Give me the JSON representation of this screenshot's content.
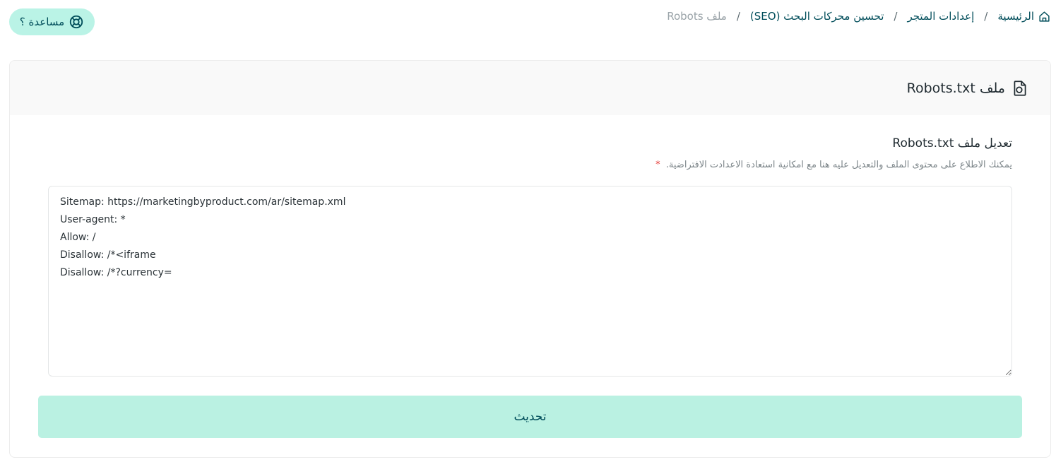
{
  "breadcrumb": {
    "home": "الرئيسية",
    "store_settings": "إعدادات المتجر",
    "seo": "تحسين محركات البحث (SEO)",
    "current": "ملف Robots",
    "separator": "/"
  },
  "help": {
    "label": "مساعدة ؟"
  },
  "card": {
    "title": "ملف Robots.txt"
  },
  "section": {
    "title": "تعديل ملف Robots.txt",
    "description": "يمكنك الاطلاع على محتوى الملف والتعديل عليه هنا مع امكانية استعادة الاعدادت الافتراضية.",
    "required_mark": "*"
  },
  "editor": {
    "value": "Sitemap: https://marketingbyproduct.com/ar/sitemap.xml\nUser-agent: *\nAllow: /\nDisallow: /*<iframe\nDisallow: /*?currency="
  },
  "actions": {
    "update_label": "تحديث"
  },
  "colors": {
    "accent": "#baf3e6",
    "primary_text": "#004d5a",
    "required": "#e53935"
  }
}
